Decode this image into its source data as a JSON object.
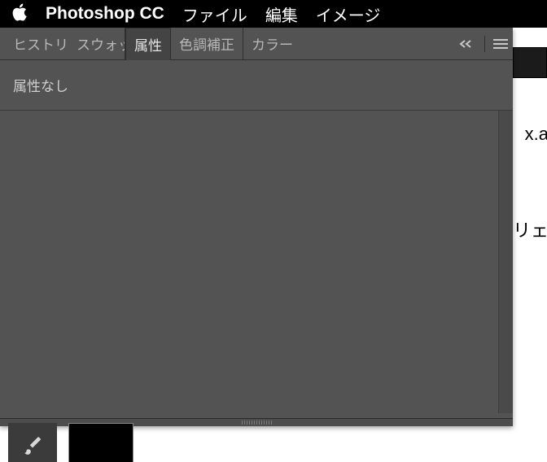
{
  "menubar": {
    "app_name": "Photoshop CC",
    "items": [
      "ファイル",
      "編集",
      "イメージ"
    ]
  },
  "panel": {
    "tabs": [
      {
        "label": "ヒストリ",
        "active": false
      },
      {
        "label": "スウォッチ",
        "active": false
      },
      {
        "label": "属性",
        "active": true
      },
      {
        "label": "色調補正",
        "active": false
      },
      {
        "label": "カラー",
        "active": false
      }
    ],
    "status_text": "属性なし"
  },
  "background": {
    "addr_fragment": "x.a",
    "text_fragment": "リェ"
  }
}
